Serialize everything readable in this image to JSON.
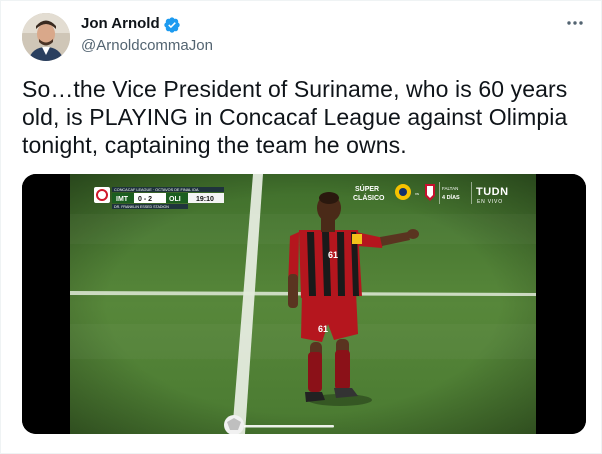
{
  "tweet": {
    "author": {
      "display_name": "Jon Arnold",
      "handle": "@ArnoldcommaJon",
      "verified": true,
      "avatar_icon": "avatar"
    },
    "text": "So…the Vice President of Suriname, who is 60 years old, is PLAYING in Concacaf League against Olimpia tonight, captaining the team he owns.",
    "more_icon": "more-icon",
    "media": {
      "scoreboard": {
        "competition": "CONCACAF LEAGUE · OCTAVOS DE FINAL IDA",
        "home_team": "IMT",
        "score": "0 - 2",
        "away_team": "OLI",
        "clock": "19:10",
        "stadium": "DR. FRANKLIN ESSED STADION"
      },
      "promo": {
        "line1": "SÚPER",
        "line2": "CLÁSICO",
        "faltan": "FALTAN",
        "days": "4 DÍAS"
      },
      "broadcaster": {
        "name": "TUDN",
        "tagline": "EN VIVO"
      },
      "player_number": "61"
    }
  },
  "colors": {
    "verified": "#1d9bf0",
    "pitch": "#4f7d34",
    "jersey_red": "#b5161e"
  }
}
